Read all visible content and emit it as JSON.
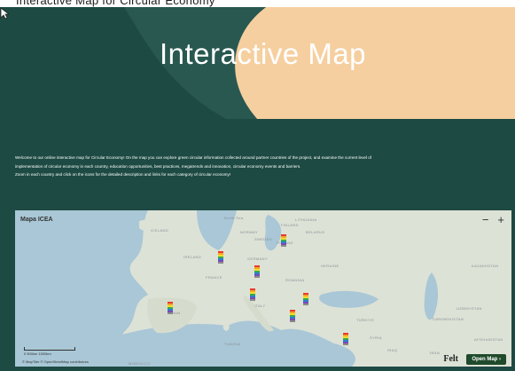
{
  "page": {
    "top_strip_text": "Interactive Map for Circular Economy",
    "hero_title": "Interactive Map",
    "intro_line_1": "Welcome to our online interactive map for Circular Economy! On the map you can explore green circular information collected around partner countries of the project, and examine the current level of",
    "intro_line_2": "implementation of circular economy in each country, education opportunities, best practices, megatrends and innovation, circular economy events and barriers.",
    "intro_line_3": "Zoom in each country and click on the icons for the detailed description and links for each category of circular economy!"
  },
  "colors": {
    "page_bg": "#1d4a43",
    "hero_peach": "#f6cfa0",
    "hero_band": "#2a5a52",
    "map_land": "#dde2d6",
    "map_sea": "#a9c7d6",
    "open_map_bg": "#1f4a2b"
  },
  "map": {
    "title": "Mapa ICEA",
    "zoom_out": "−",
    "zoom_in": "+",
    "countries": {
      "iceland": "ICELAND",
      "norway": "NORWAY",
      "finland": "FINLAND",
      "sweden": "SWEDEN",
      "lithuania": "LITHUANIA",
      "belarus": "BELARUS",
      "poland": "POLAND",
      "ireland": "IRELAND",
      "germany": "GERMANY",
      "ukraine": "UKRAINE",
      "france": "FRANCE",
      "kazakhstan": "KAZAKHSTAN",
      "romania": "ROMANIA",
      "spain": "SPAIN",
      "italy": "ITALY",
      "turkey": "TÜRKIYE",
      "uzbekistan": "UZBEKISTAN",
      "turkmenistan": "TURKMENISTAN",
      "tunisia": "TUNISIA",
      "syria": "SYRIA",
      "afghanistan": "AFGHANISTAN",
      "morocco": "MOROCCO",
      "iraq": "IRAQ",
      "iran": "IRAN",
      "north_sea": "North Sea"
    },
    "scale_labels": "0      500km      1000km",
    "attribution": "© MapTiler  © OpenStreetMap contributors",
    "felt_logo": "Felt",
    "open_map_label": "Open Map ›"
  }
}
